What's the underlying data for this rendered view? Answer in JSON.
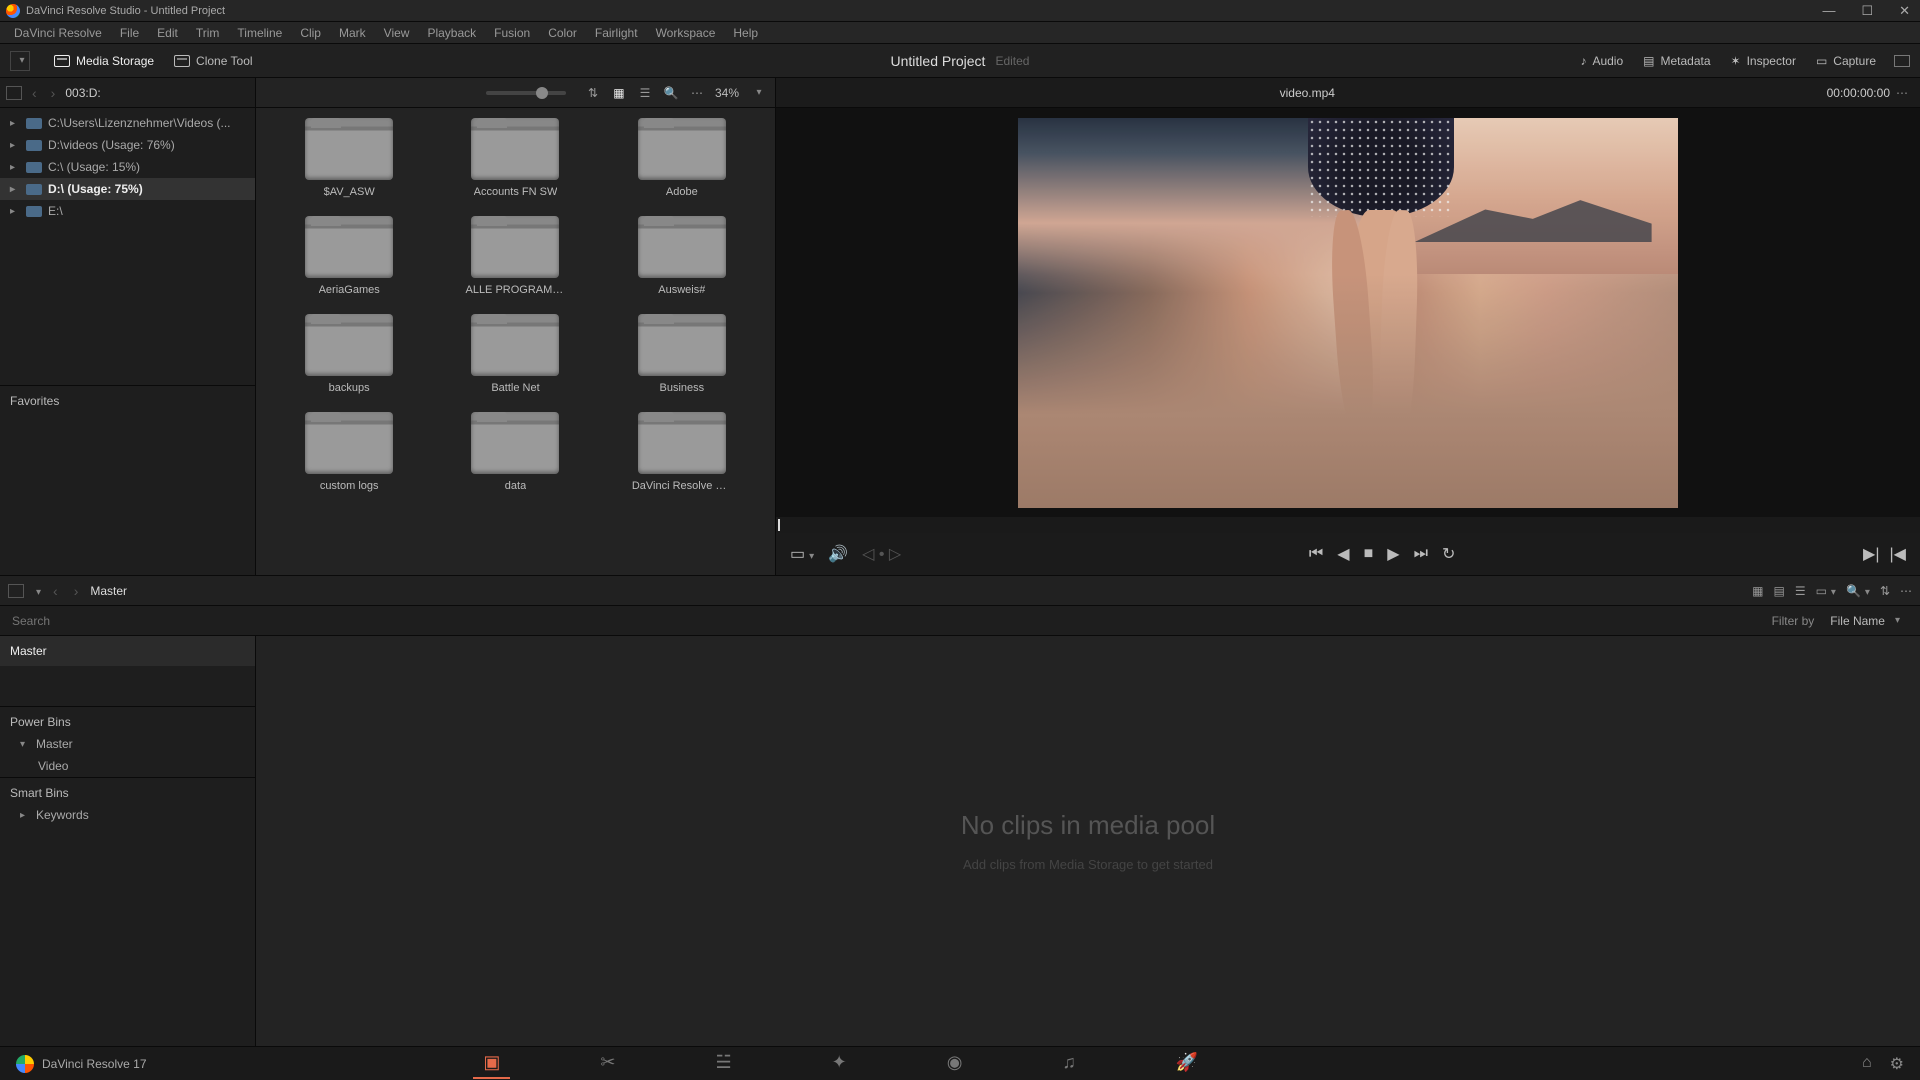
{
  "window": {
    "title": "DaVinci Resolve Studio - Untitled Project"
  },
  "menu": [
    "DaVinci Resolve",
    "File",
    "Edit",
    "Trim",
    "Timeline",
    "Clip",
    "Mark",
    "View",
    "Playback",
    "Fusion",
    "Color",
    "Fairlight",
    "Workspace",
    "Help"
  ],
  "toolbar": {
    "media_storage": "Media Storage",
    "clone_tool": "Clone Tool",
    "project_title": "Untitled Project",
    "edited": "Edited",
    "audio": "Audio",
    "metadata": "Metadata",
    "inspector": "Inspector",
    "capture": "Capture"
  },
  "media_storage": {
    "path_label": "003:D:",
    "drives": [
      {
        "label": "C:\\Users\\Lizenznehmer\\Videos (...",
        "active": false
      },
      {
        "label": "D:\\videos (Usage: 76%)",
        "active": false
      },
      {
        "label": "C:\\ (Usage: 15%)",
        "active": false
      },
      {
        "label": "D:\\ (Usage: 75%)",
        "active": true
      },
      {
        "label": "E:\\",
        "active": false
      }
    ],
    "favorites_label": "Favorites",
    "zoom": "34%",
    "folders": [
      "$AV_ASW",
      "Accounts FN SW",
      "Adobe",
      "AeriaGames",
      "ALLE PROGRAMME",
      "Ausweis#",
      "backups",
      "Battle Net",
      "Business",
      "custom logs",
      "data",
      "DaVinci Resolve Wor..."
    ]
  },
  "viewer": {
    "clip_name": "video.mp4",
    "timecode": "00:00:00:00"
  },
  "media_pool": {
    "breadcrumb": "Master",
    "search_placeholder": "Search",
    "filter_label": "Filter by",
    "filter_value": "File Name",
    "bins": {
      "master": "Master",
      "power_bins": "Power Bins",
      "pb_master": "Master",
      "pb_video": "Video",
      "smart_bins": "Smart Bins",
      "keywords": "Keywords"
    },
    "empty_msg": "No clips in media pool",
    "empty_sub": "Add clips from Media Storage to get started"
  },
  "footer": {
    "brand": "DaVinci Resolve 17"
  }
}
